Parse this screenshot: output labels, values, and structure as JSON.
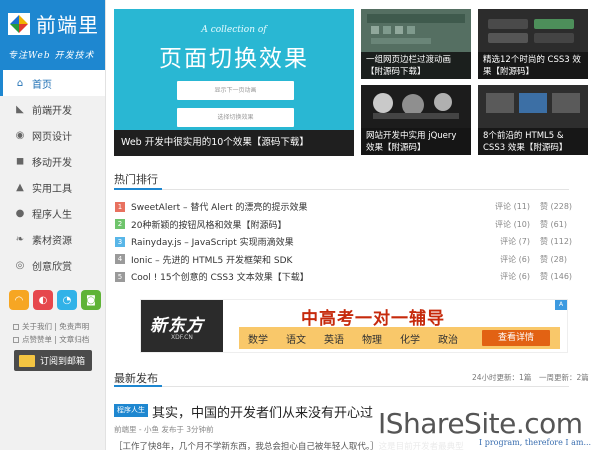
{
  "logo": {
    "title": "前端里",
    "subtitle": "专注Web 开发技术"
  },
  "nav": [
    {
      "label": "首页",
      "icon": "home-icon",
      "glyph": "⌂",
      "active": true
    },
    {
      "label": "前端开发",
      "icon": "send-icon",
      "glyph": "◣"
    },
    {
      "label": "网页设计",
      "icon": "compass-icon",
      "glyph": "◉"
    },
    {
      "label": "移动开发",
      "icon": "chat-icon",
      "glyph": "◼"
    },
    {
      "label": "实用工具",
      "icon": "thumbs-up-icon",
      "glyph": "▲"
    },
    {
      "label": "程序人生",
      "icon": "user-icon",
      "glyph": "●"
    },
    {
      "label": "素材资源",
      "icon": "leaf-icon",
      "glyph": "❧"
    },
    {
      "label": "创意欣赏",
      "icon": "eye-icon",
      "glyph": "◎"
    }
  ],
  "socials": [
    {
      "name": "rss-icon",
      "glyph": "◠",
      "color": "#f6a623"
    },
    {
      "name": "weibo-icon",
      "glyph": "◐",
      "color": "#e6474d"
    },
    {
      "name": "qq-icon",
      "glyph": "◔",
      "color": "#31b2e8"
    },
    {
      "name": "wechat-icon",
      "glyph": "◙",
      "color": "#5fb336"
    }
  ],
  "side_links": [
    "关于我们 | 免责声明",
    "点赞赞单 | 文章归档"
  ],
  "subscribe_label": "订阅到邮箱",
  "featured": {
    "big": {
      "script": "A collection of",
      "heading": "页面切换效果",
      "btn1": "显示下一页动画",
      "btn2": "选择切换效果",
      "caption": "Web 开发中很实用的10个效果【源码下载】",
      "color": "#29b7d3"
    },
    "tiles": [
      {
        "caption": "一组网页边栏过渡动画【附源码下载】"
      },
      {
        "caption": "精选12个时尚的 CSS3 效果【附源码】"
      },
      {
        "caption": "网站开发中实用 jQuery 效果【附源码】"
      },
      {
        "caption": "8个前沿的 HTML5 & CSS3 效果【附源码】"
      }
    ]
  },
  "hot": {
    "title": "热门排行",
    "items": [
      {
        "n": "1",
        "title": "SweetAlert – 替代 Alert 的漂亮的提示效果",
        "comments": "评论 (11)",
        "likes": "赞 (228)",
        "color": "#e8715f"
      },
      {
        "n": "2",
        "title": "20种新颖的按钮风格和效果【附源码】",
        "comments": "评论 (10)",
        "likes": "赞 (61)",
        "color": "#6fc46c"
      },
      {
        "n": "3",
        "title": "Rainyday.js – JavaScript 实现雨滴效果",
        "comments": "评论 (7)",
        "likes": "赞 (112)",
        "color": "#58b6e8"
      },
      {
        "n": "4",
        "title": "Ionic – 先进的 HTML5 开发框架和 SDK",
        "comments": "评论 (6)",
        "likes": "赞 (28)",
        "color": "#9a9a9a"
      },
      {
        "n": "5",
        "title": "Cool ! 15个创意的 CSS3 文本效果【下载】",
        "comments": "评论 (6)",
        "likes": "赞 (146)",
        "color": "#9a9a9a"
      }
    ]
  },
  "ad": {
    "brand": "新东方",
    "brand_sub": "XDF.CN",
    "headline": "中高考一对一辅导",
    "subjects": [
      "数学",
      "语文",
      "英语",
      "物理",
      "化学",
      "政治"
    ],
    "cta": "查看详情",
    "badge": "A"
  },
  "latest": {
    "title": "最新发布",
    "stat_24h": "24小时更新：1篇",
    "stat_week": "一周更新：2篇",
    "post": {
      "category": "程序人生",
      "title": "其实，中国的开发者们从来没有开心过",
      "meta": "前端里 - 小鱼 发布于 3分钟前",
      "excerpt": "［工作了快8年，几个月不学新东西，我总会担心自己被年轻人取代。］这是目前开发者最典型"
    }
  },
  "watermark": {
    "site": "IShareSite.com",
    "motto": "I program, therefore I am..."
  }
}
